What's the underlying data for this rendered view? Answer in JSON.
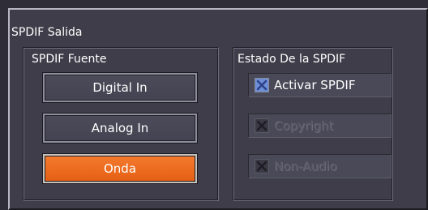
{
  "panel": {
    "title": "SPDIF Salida"
  },
  "source_group": {
    "title": "SPDIF Fuente",
    "buttons": [
      {
        "label": "Digital In",
        "selected": false
      },
      {
        "label": "Analog In",
        "selected": false
      },
      {
        "label": "Onda",
        "selected": true
      }
    ]
  },
  "status_group": {
    "title": "Estado De la SPDIF",
    "options": [
      {
        "label": "Activar SPDIF",
        "checked": true,
        "enabled": true
      },
      {
        "label": "Copyright",
        "checked": true,
        "enabled": false
      },
      {
        "label": "Non-Audio",
        "checked": true,
        "enabled": false
      }
    ]
  },
  "colors": {
    "background": "#3e3d49",
    "selected_button": "#f0701f",
    "checkbox_checked": "#6c8fd8"
  }
}
